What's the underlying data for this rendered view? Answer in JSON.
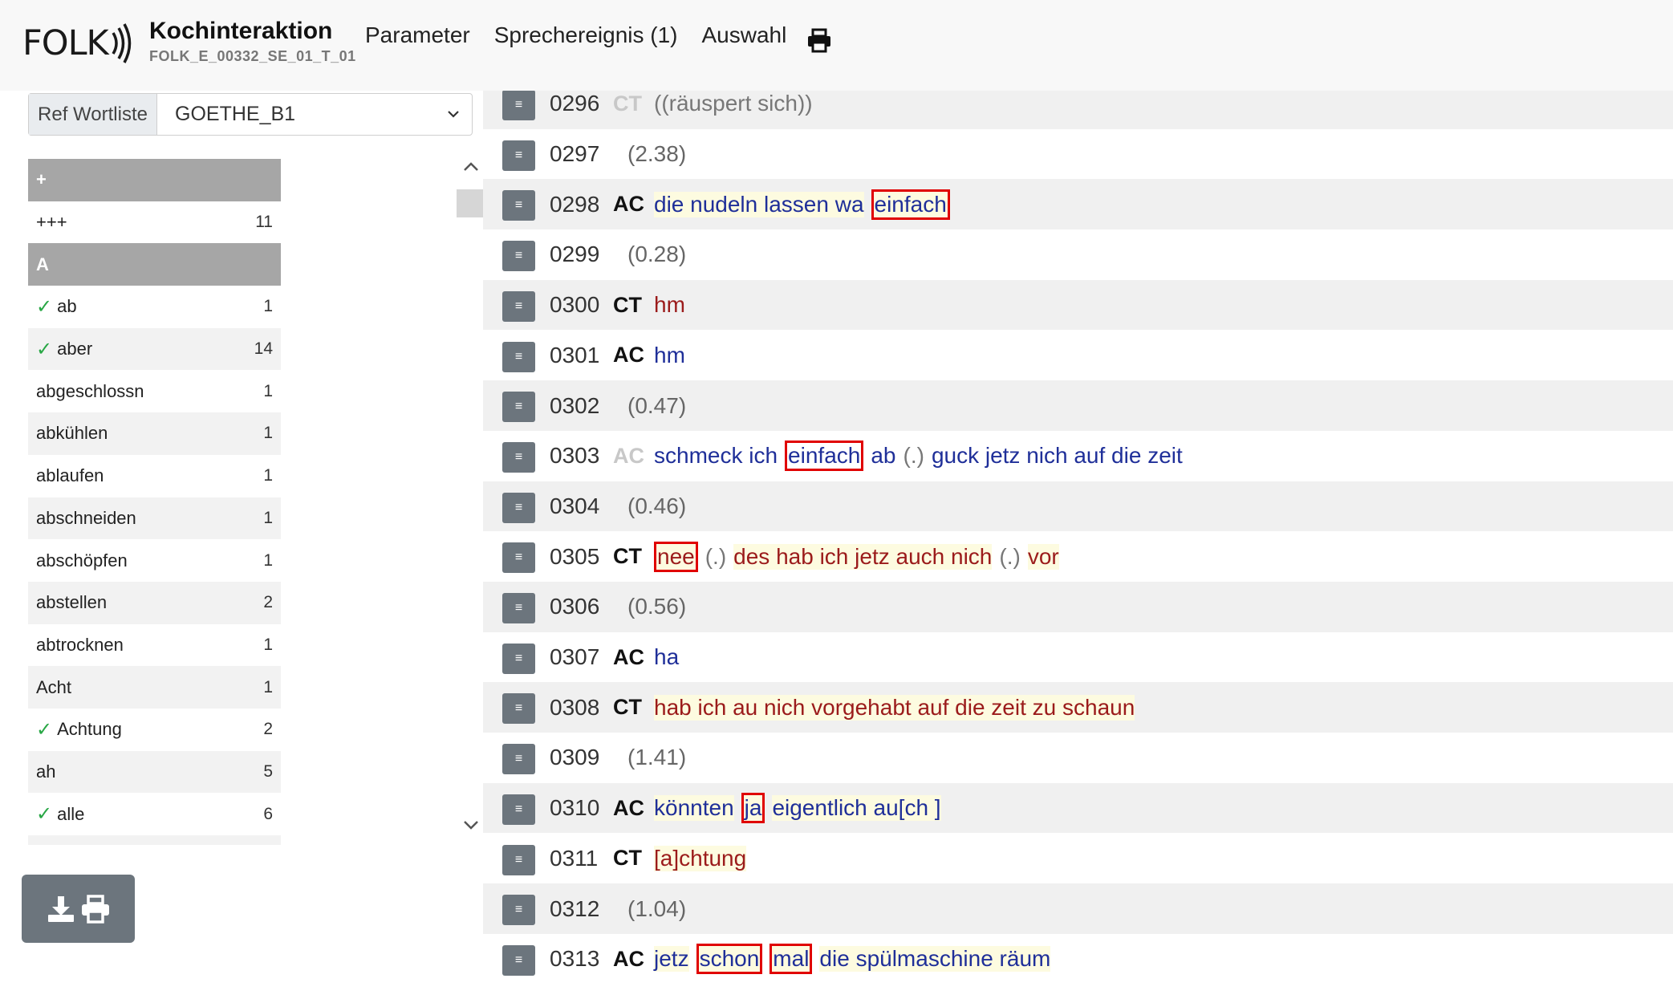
{
  "header": {
    "logo_text": "FOLK",
    "title": "Kochinteraktion",
    "subtitle": "FOLK_E_00332_SE_01_T_01",
    "nav": [
      "Parameter",
      "Sprechereignis (1)",
      "Auswahl"
    ]
  },
  "sidebar": {
    "ref_label": "Ref Wortliste",
    "ref_value": "GOETHE_B1",
    "words": [
      {
        "word": "+",
        "count": "",
        "group": true,
        "checked": false
      },
      {
        "word": "+++",
        "count": "11",
        "group": false,
        "checked": false
      },
      {
        "word": "A",
        "count": "",
        "group": true,
        "checked": false
      },
      {
        "word": "ab",
        "count": "1",
        "group": false,
        "checked": true
      },
      {
        "word": "aber",
        "count": "14",
        "group": false,
        "checked": true
      },
      {
        "word": "abgeschlossn",
        "count": "1",
        "group": false,
        "checked": false
      },
      {
        "word": "abkühlen",
        "count": "1",
        "group": false,
        "checked": false
      },
      {
        "word": "ablaufen",
        "count": "1",
        "group": false,
        "checked": false
      },
      {
        "word": "abschneiden",
        "count": "1",
        "group": false,
        "checked": false
      },
      {
        "word": "abschöpfen",
        "count": "1",
        "group": false,
        "checked": false
      },
      {
        "word": "abstellen",
        "count": "2",
        "group": false,
        "checked": false
      },
      {
        "word": "abtrocknen",
        "count": "1",
        "group": false,
        "checked": false
      },
      {
        "word": "Acht",
        "count": "1",
        "group": false,
        "checked": false
      },
      {
        "word": "Achtung",
        "count": "2",
        "group": false,
        "checked": true
      },
      {
        "word": "ah",
        "count": "5",
        "group": false,
        "checked": false
      },
      {
        "word": "alle",
        "count": "6",
        "group": false,
        "checked": true
      },
      {
        "word": "",
        "count": "",
        "group": false,
        "checked": false
      }
    ],
    "check_mark": "✓"
  },
  "transcript": {
    "rows": [
      {
        "num": "0296",
        "speaker": "CT",
        "speaker_faded": true,
        "type": "text",
        "cls": "note",
        "tokens": [
          {
            "t": "((räuspert sich))"
          }
        ]
      },
      {
        "num": "0297",
        "speaker": "",
        "type": "pause",
        "tokens": [
          {
            "t": "(2.38)"
          }
        ]
      },
      {
        "num": "0298",
        "speaker": "AC",
        "type": "text",
        "cls": "ac",
        "tokens": [
          {
            "t": "die nudeln lassen wa",
            "hl": true
          },
          {
            "t": "einfach",
            "hl": true,
            "mark": true
          }
        ]
      },
      {
        "num": "0299",
        "speaker": "",
        "type": "pause",
        "tokens": [
          {
            "t": "(0.28)"
          }
        ]
      },
      {
        "num": "0300",
        "speaker": "CT",
        "type": "text",
        "cls": "ct",
        "tokens": [
          {
            "t": "hm"
          }
        ]
      },
      {
        "num": "0301",
        "speaker": "AC",
        "type": "text",
        "cls": "ac",
        "tokens": [
          {
            "t": "hm"
          }
        ]
      },
      {
        "num": "0302",
        "speaker": "",
        "type": "pause",
        "tokens": [
          {
            "t": "(0.47)"
          }
        ]
      },
      {
        "num": "0303",
        "speaker": "AC",
        "speaker_faded": true,
        "type": "text",
        "cls": "ac",
        "tokens": [
          {
            "t": "schmeck ich"
          },
          {
            "t": "einfach",
            "mark": true
          },
          {
            "t": "ab"
          },
          {
            "t": "(.)",
            "note": true
          },
          {
            "t": "guck jetz nich auf die zeit"
          }
        ]
      },
      {
        "num": "0304",
        "speaker": "",
        "type": "pause",
        "tokens": [
          {
            "t": "(0.46)"
          }
        ]
      },
      {
        "num": "0305",
        "speaker": "CT",
        "type": "text",
        "cls": "ct",
        "tokens": [
          {
            "t": "nee",
            "hl": true,
            "mark": true
          },
          {
            "t": "(.)",
            "note": true
          },
          {
            "t": "des hab ich jetz auch nich",
            "hl": true
          },
          {
            "t": "(.)",
            "note": true
          },
          {
            "t": "vor",
            "hl": true
          }
        ]
      },
      {
        "num": "0306",
        "speaker": "",
        "type": "pause",
        "tokens": [
          {
            "t": "(0.56)"
          }
        ]
      },
      {
        "num": "0307",
        "speaker": "AC",
        "type": "text",
        "cls": "ac",
        "tokens": [
          {
            "t": "ha"
          }
        ]
      },
      {
        "num": "0308",
        "speaker": "CT",
        "type": "text",
        "cls": "ct",
        "tokens": [
          {
            "t": "hab ich au nich vorgehabt auf die zeit zu schaun",
            "hl": true
          }
        ]
      },
      {
        "num": "0309",
        "speaker": "",
        "type": "pause",
        "tokens": [
          {
            "t": "(1.41)"
          }
        ]
      },
      {
        "num": "0310",
        "speaker": "AC",
        "type": "text",
        "cls": "ac",
        "tokens": [
          {
            "t": "könnten",
            "hl": true
          },
          {
            "t": "ja",
            "hl": true,
            "mark": true
          },
          {
            "t": "eigentlich au[ch ]",
            "hl": true
          }
        ]
      },
      {
        "num": "0311",
        "speaker": "CT",
        "type": "text",
        "cls": "ct",
        "tokens": [
          {
            "t": "[a]chtung",
            "hl": true
          }
        ]
      },
      {
        "num": "0312",
        "speaker": "",
        "type": "pause",
        "tokens": [
          {
            "t": "(1.04)"
          }
        ]
      },
      {
        "num": "0313",
        "speaker": "AC",
        "type": "text",
        "cls": "ac",
        "tokens": [
          {
            "t": "jetz",
            "hl": true
          },
          {
            "t": "schon",
            "hl": true,
            "mark": true
          },
          {
            "t": "mal",
            "hl": true,
            "mark": true
          },
          {
            "t": "die spülmaschine räum",
            "hl": true
          }
        ]
      }
    ]
  }
}
